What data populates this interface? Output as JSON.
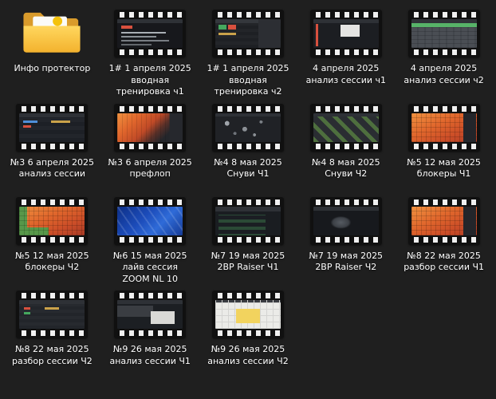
{
  "colors": {
    "background": "#1f1f1f",
    "label_text": "#ffffff",
    "folder_yellow": "#f3b22e",
    "film_black": "#101010"
  },
  "items": [
    {
      "type": "folder",
      "label": "Инфо протектор"
    },
    {
      "type": "video",
      "label": "1# 1 апреля 2025 вводная тренировка ч1",
      "thumb": "dark-ui-rows"
    },
    {
      "type": "video",
      "label": "1# 1 апреля 2025 вводная тренировка ч2",
      "thumb": "dark-ui-colored-cells"
    },
    {
      "type": "video",
      "label": "4 апреля 2025 анализ сессии ч1",
      "thumb": "dark-ui-dialog"
    },
    {
      "type": "video",
      "label": "4 апреля 2025 анализ сессии ч2",
      "thumb": "gray-matrix-green-row"
    },
    {
      "type": "video",
      "label": "№3 6 апреля 2025  анализ сессии",
      "thumb": "dark-table-rows"
    },
    {
      "type": "video",
      "label": "№3 6 апреля 2025 префлоп",
      "thumb": "orange-heatmap-corner"
    },
    {
      "type": "video",
      "label": "№4 8 мая 2025 Снуви Ч1",
      "thumb": "dark-scatter"
    },
    {
      "type": "video",
      "label": "№4 8 мая 2025 Снуви Ч2",
      "thumb": "green-diagonal-matrix"
    },
    {
      "type": "video",
      "label": "№5 12 мая 2025 блокеры Ч1",
      "thumb": "orange-range-matrix"
    },
    {
      "type": "video",
      "label": "№5 12 мая 2025 блокеры Ч2",
      "thumb": "orange-range-matrix-green"
    },
    {
      "type": "video",
      "label": "№6 15 мая 2025 лайв сессия ZOOM NL 10",
      "thumb": "blue-zoom-screen"
    },
    {
      "type": "video",
      "label": "№7 19 мая 2025 2BP Raiser Ч1",
      "thumb": "dark-green-rows"
    },
    {
      "type": "video",
      "label": "№7 19 мая 2025 2BP Raiser Ч2",
      "thumb": "dark-cluster"
    },
    {
      "type": "video",
      "label": "№8 22 мая 2025 разбор сессии Ч1",
      "thumb": "orange-range-matrix"
    },
    {
      "type": "video",
      "label": "№8 22 мая 2025 разбор сессии Ч2",
      "thumb": "dark-rows-colored-dots"
    },
    {
      "type": "video",
      "label": "№9 26 мая 2025 анализ сессии Ч1",
      "thumb": "dark-ui-light-panel"
    },
    {
      "type": "video",
      "label": "№9 26 мая 2025 анализ сессии Ч2",
      "thumb": "light-document-grid"
    }
  ]
}
